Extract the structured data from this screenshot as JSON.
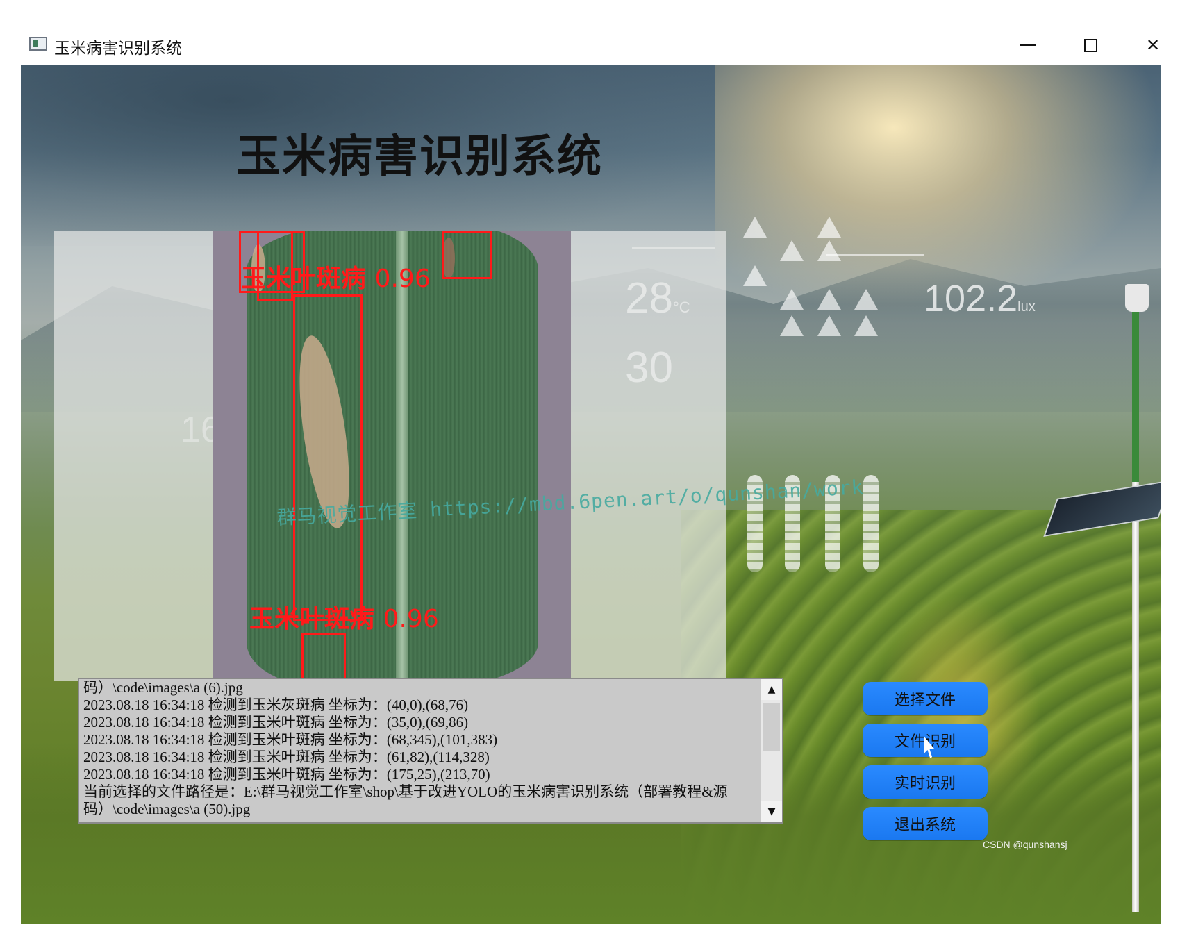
{
  "window": {
    "title": "玉米病害识别系统",
    "controls": [
      "minimize",
      "maximize",
      "close"
    ]
  },
  "header": {
    "title": "玉米病害识别系统"
  },
  "image_panel": {
    "detections": [
      {
        "label": "玉米叶斑病",
        "score": "0.96"
      },
      {
        "label": "玉米叶斑病",
        "score": "0.96"
      }
    ],
    "watermark": "群马视觉工作室 https://mbd.6pen.art/o/qunshan/work"
  },
  "background_overlay": {
    "sensor_values": [
      "28",
      "30",
      "102.2",
      "16"
    ],
    "sensor_units": [
      "°C",
      "lux"
    ]
  },
  "log": {
    "lines": [
      "码）\\code\\images\\a (6).jpg",
      "2023.08.18 16:34:18 检测到玉米灰斑病 坐标为：(40,0),(68,76)",
      "2023.08.18 16:34:18 检测到玉米叶斑病 坐标为：(35,0),(69,86)",
      "2023.08.18 16:34:18 检测到玉米叶斑病 坐标为：(68,345),(101,383)",
      "2023.08.18 16:34:18 检测到玉米叶斑病 坐标为：(61,82),(114,328)",
      "2023.08.18 16:34:18 检测到玉米叶斑病 坐标为：(175,25),(213,70)",
      "当前选择的文件路径是：E:\\群马视觉工作室\\shop\\基于改进YOLO的玉米病害识别系统（部署教程&源",
      "码）\\code\\images\\a (50).jpg"
    ]
  },
  "buttons": {
    "select_file": "选择文件",
    "file_detect": "文件识别",
    "realtime_detect": "实时识别",
    "exit": "退出系统"
  },
  "footer": {
    "credit": "CSDN @qunshansj"
  },
  "colors": {
    "button_bg": "#1a78f0",
    "detection_box": "#ff1a1a",
    "log_bg": "#c9c9c9"
  }
}
